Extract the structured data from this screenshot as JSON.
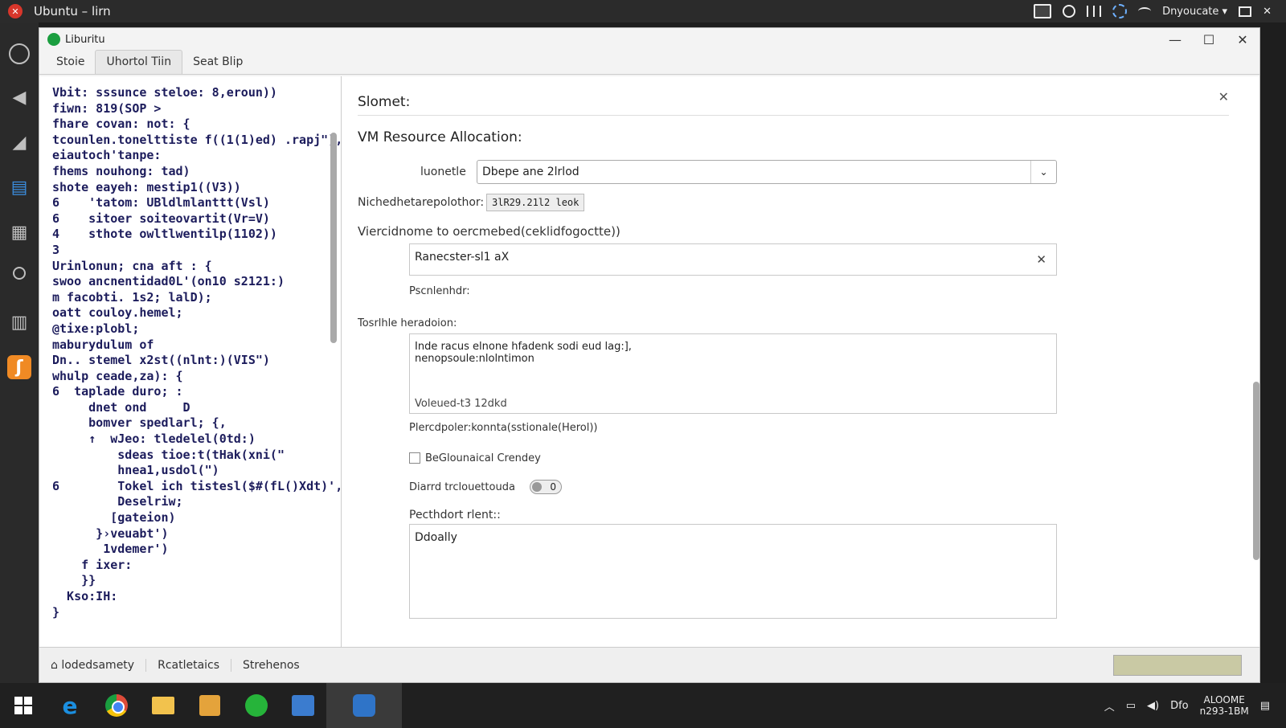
{
  "topbar": {
    "title": "Ubuntu – lirn",
    "user_label": "Dnyoucate"
  },
  "window": {
    "title": "Liburitu",
    "tabs": [
      "Stoie",
      "Uhortol Tiin",
      "Seat Blip"
    ]
  },
  "code_lines": [
    "Vbit: sssunce steloe: 8,eroun))",
    "fiwn: 819(SOP >",
    "fhare covan: not: {",
    "tcounlen.tonelttiste f((1(1)ed) .rapj\"),",
    "eiautoch'tanpe:",
    "fhems nouhong: tad)",
    "shote eayeh: mestip1((V3))",
    "6    'tatom: UBldlmlanttt(Vsl)",
    "6    sitoer soiteovartit(Vr=V)",
    "4    sthote owltlwentilp(1102))",
    "3",
    "Urinlonun; cna aft : {",
    "swoo ancnentidad0L'(on10 s2121:)",
    "m facobti. 1s2; lalD);",
    "oatt couloy.hemel;",
    "@tixe:plobl;",
    "maburydulum of",
    "Dn.. stemel x2st((nlnt:)(VIS\")",
    "whulp ceade,za): {",
    "6  taplade duro; :",
    "     dnet ond     D",
    "     bomver spedlarl; {,",
    "     ↑  wJeo: tledelel(0td:)",
    "         sdeas tioe:t(tHak(xni(\"",
    "         hnea1,usdol(\")",
    "6        Tokel ich tistesl($#(fL()Xdt)',",
    "         Deselriw;",
    "        [gateion)",
    "      }›veuabt')",
    "       1vdemer')",
    "    f ixer:",
    "    }}",
    "  Kso:IH:",
    "}"
  ],
  "form": {
    "header": "Slomet:",
    "section_title": "VM Resource Allocation:",
    "select_label": "luonetle",
    "select_value": "Dbepe ane 2lrlod",
    "chip_label": "Nichedhetarepolothor:",
    "chip_value": "3lR29.21l2 leok",
    "input_label": "Viercidnome to oercmebed(ceklidfogoctte))",
    "input_value": "Ranecster-sl1 aX",
    "placeholder_note": "Pscnlenhdr:",
    "textarea_label": "Tosrlhle heradoion:",
    "textarea_lines": [
      "Inde racus elnone hfadenk sodi eud lag:],",
      "nenopsoule:nlolntimon"
    ],
    "textarea_footer": "Voleued-t3 12dkd",
    "helper_text": "Plercdpoler:konnta(sstionale(Herol))",
    "checkbox_label": "BeGlounaical Crendey",
    "toggle_label": "Diarrd trclouettouda",
    "toggle_value": "0",
    "notes_label": "Pecthdort rlent::",
    "notes_value": "Ddoally"
  },
  "statusbar": {
    "items": [
      "lodedsamety",
      "Rcatletaics",
      "Strehenos"
    ]
  },
  "taskbar": {
    "tray_text": "Dfo",
    "clock_line1": "ALOOME",
    "clock_line2": "n293-1BM"
  }
}
